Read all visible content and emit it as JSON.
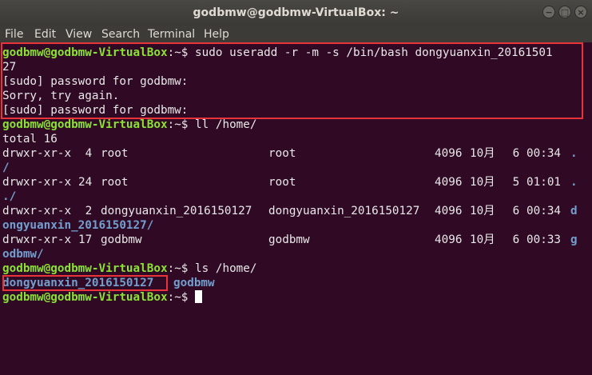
{
  "window": {
    "title": "godbmw@godbmw-VirtualBox: ~",
    "minimize_glyph": "−",
    "maximize_glyph": "□",
    "close_glyph": "×"
  },
  "menu": [
    "File",
    "Edit",
    "View",
    "Search",
    "Terminal",
    "Help"
  ],
  "prompt": "godbmw@godbmw-VirtualBox",
  "prompt_suffix": ":~$",
  "lines": {
    "cmd1": " sudo useradd -r -m -s /bin/bash dongyuanxin_20161501",
    "cmd1_wrap": "27",
    "sudo1": "[sudo] password for godbmw:",
    "sorry": "Sorry, try again.",
    "sudo2": "[sudo] password for godbmw:",
    "cmd2": " ll /home/",
    "total": "total 16",
    "cmd3": " ls /home/",
    "cmd4": " "
  },
  "listing": [
    {
      "perm": "drwxr-xr-x",
      "links": " 4",
      "owner": "root",
      "group": "root",
      "size": "4096",
      "month": "10月",
      "day": " 6",
      "time": "00:34",
      "name": ".",
      "name_wrap": "/"
    },
    {
      "perm": "drwxr-xr-x",
      "links": "24",
      "owner": "root",
      "group": "root",
      "size": "4096",
      "month": "10月",
      "day": " 5",
      "time": "01:01",
      "name": ".",
      "name_wrap": "./"
    },
    {
      "perm": "drwxr-xr-x",
      "links": " 2",
      "owner": "dongyuanxin_2016150127",
      "group": "dongyuanxin_2016150127",
      "size": "4096",
      "month": "10月",
      "day": " 6",
      "time": "00:34",
      "name": "d",
      "name_wrap": "ongyuanxin_2016150127/"
    },
    {
      "perm": "drwxr-xr-x",
      "links": "17",
      "owner": "godbmw",
      "group": "godbmw",
      "size": "4096",
      "month": "10月",
      "day": " 6",
      "time": "00:33",
      "name": "g",
      "name_wrap": "odbmw/"
    }
  ],
  "ls_output": [
    "dongyuanxin_2016150127",
    "godbmw"
  ],
  "colors": {
    "background": "#300a24",
    "prompt": "#8ae234",
    "directory": "#729fcf",
    "text": "#e8e8e8",
    "highlight_box": "#e8333a"
  }
}
